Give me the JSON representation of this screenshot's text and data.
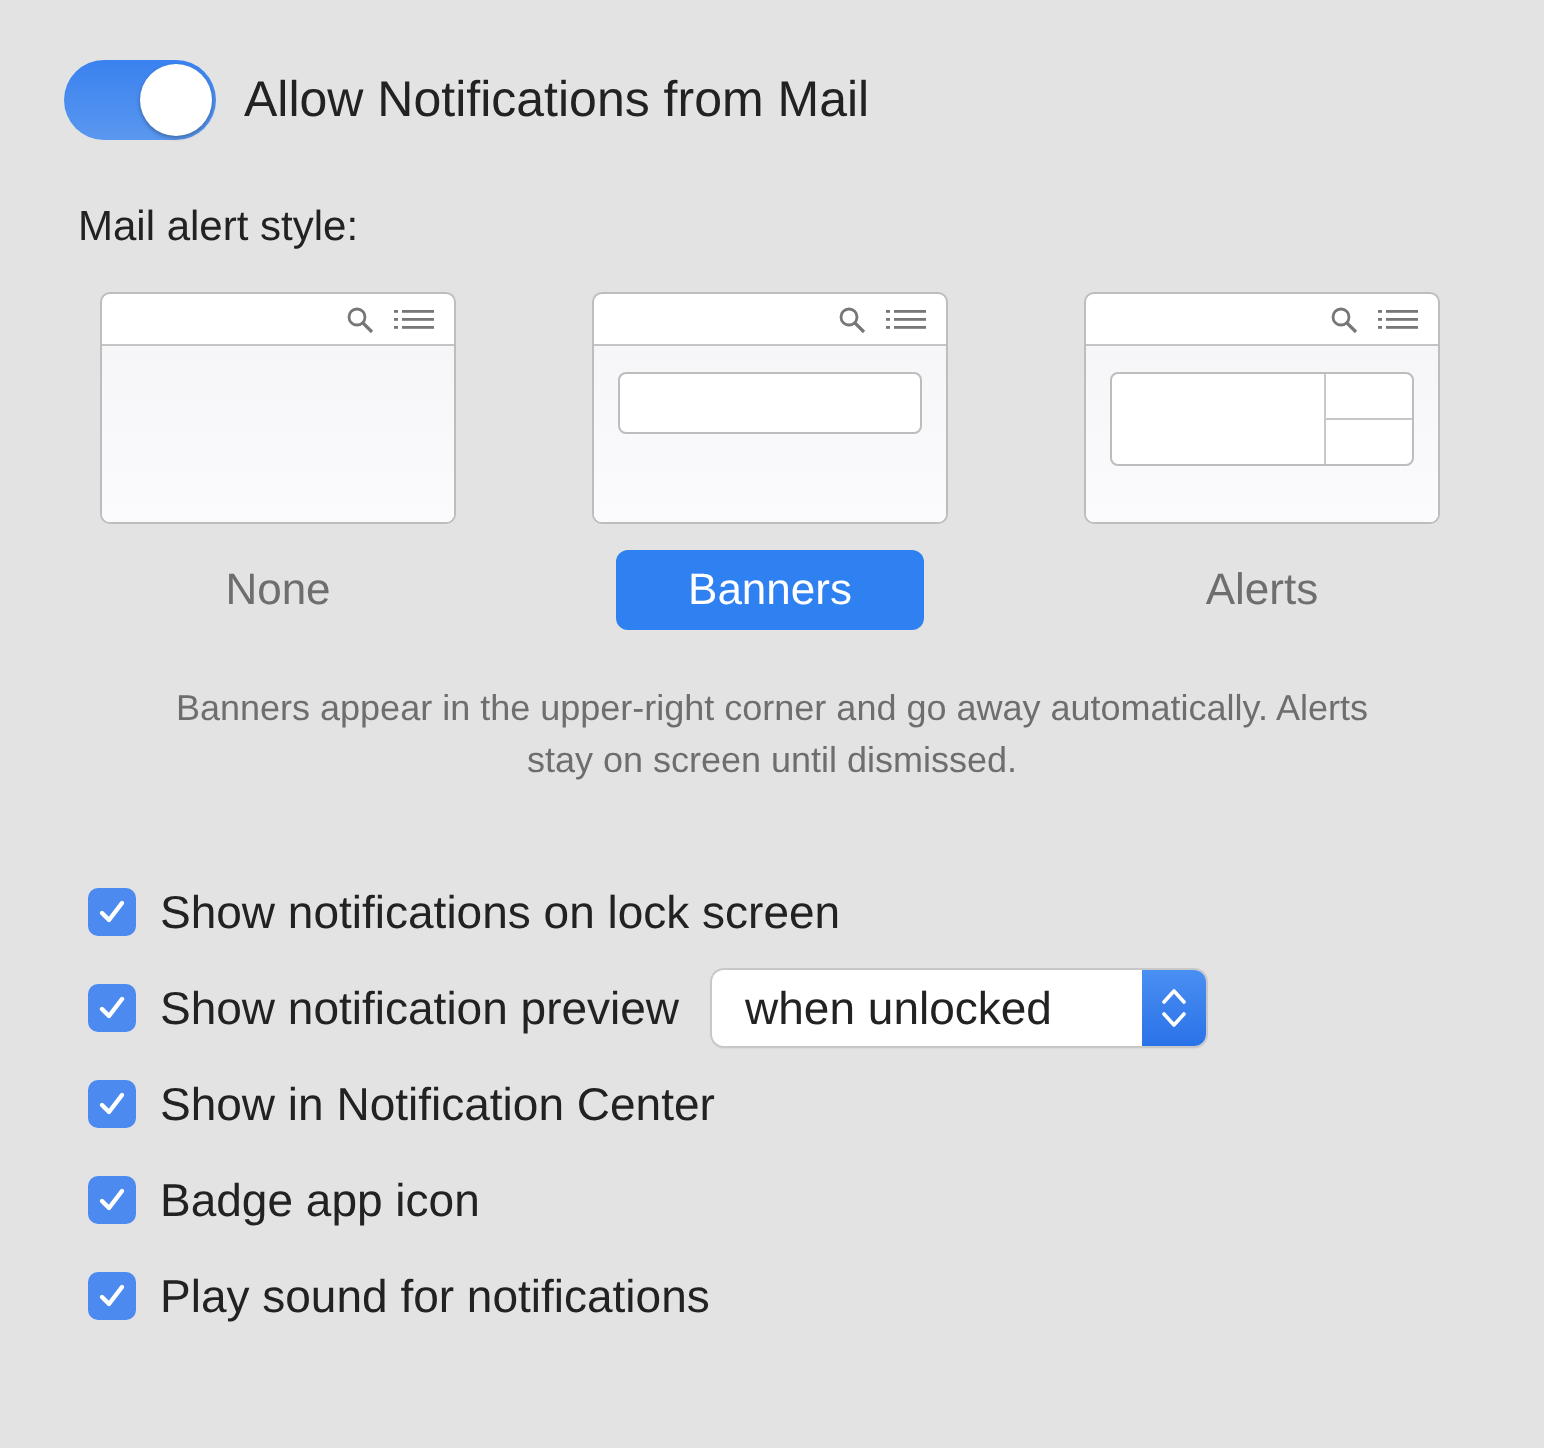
{
  "allow_toggle": {
    "label": "Allow Notifications from Mail",
    "on": true
  },
  "alert_style": {
    "label": "Mail alert style:",
    "options": [
      {
        "kind": "none",
        "label": "None",
        "selected": false
      },
      {
        "kind": "banner",
        "label": "Banners",
        "selected": true
      },
      {
        "kind": "alert",
        "label": "Alerts",
        "selected": false
      }
    ],
    "description": "Banners appear in the upper-right corner and go away automatically. Alerts stay on screen until dismissed."
  },
  "options": [
    {
      "label": "Show notifications on lock screen",
      "checked": true
    },
    {
      "label": "Show notification preview",
      "checked": true,
      "popup": {
        "value": "when unlocked"
      }
    },
    {
      "label": "Show in Notification Center",
      "checked": true
    },
    {
      "label": "Badge app icon",
      "checked": true
    },
    {
      "label": "Play sound for notifications",
      "checked": true
    }
  ]
}
